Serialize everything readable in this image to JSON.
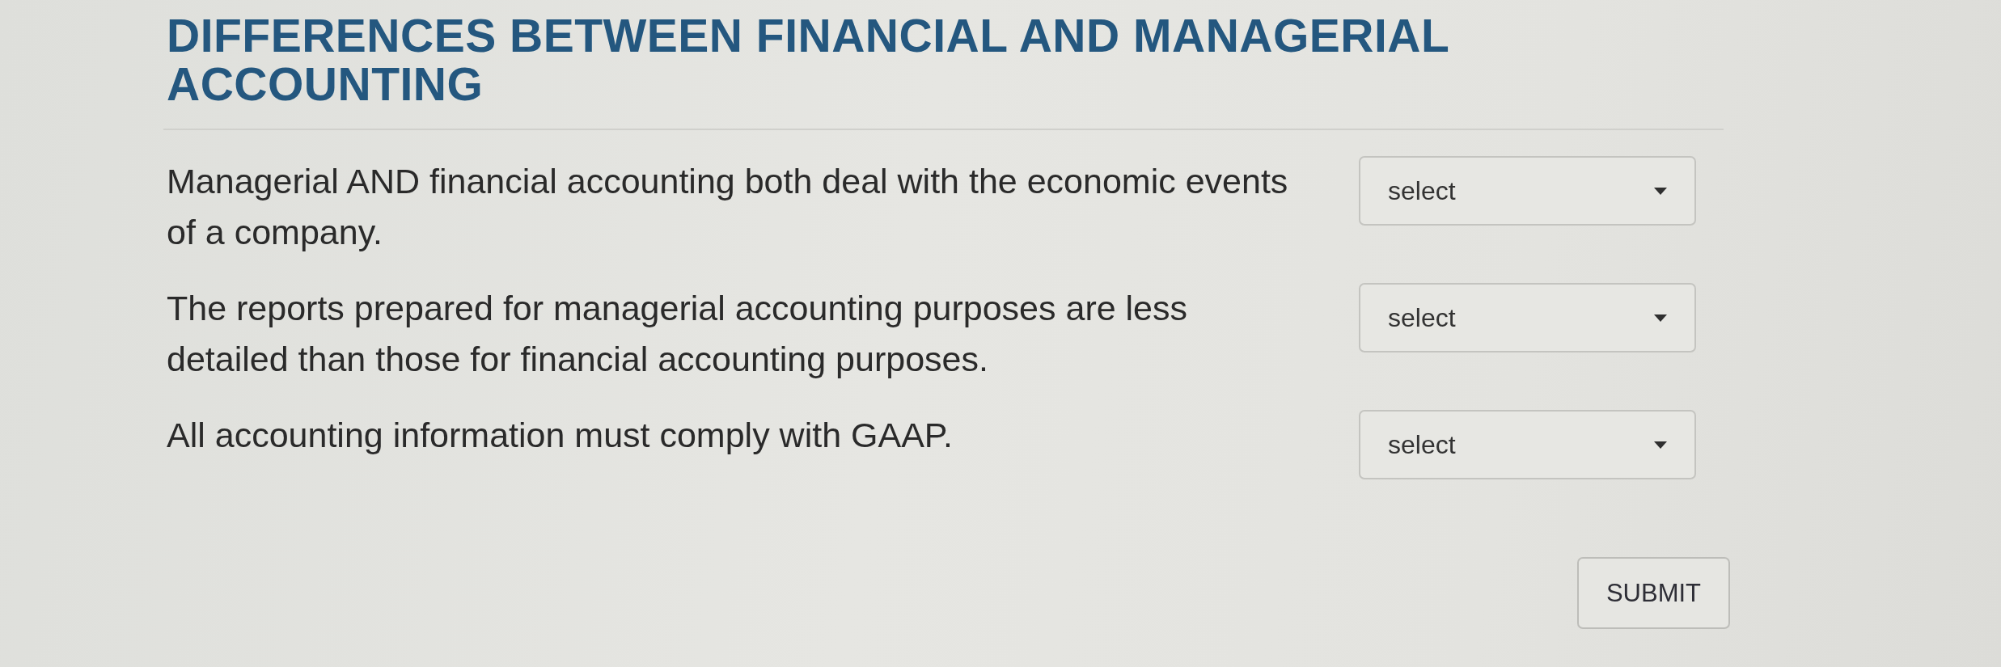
{
  "title": "DIFFERENCES BETWEEN FINANCIAL AND MANAGERIAL ACCOUNTING",
  "questions": [
    {
      "text": "Managerial AND financial accounting both deal with the economic events of a company.",
      "select": {
        "placeholder": "select"
      }
    },
    {
      "text": "The reports prepared for managerial accounting purposes are less detailed than those for financial accounting purposes.",
      "select": {
        "placeholder": "select"
      }
    },
    {
      "text": "All accounting information must comply with GAAP.",
      "select": {
        "placeholder": "select"
      }
    }
  ],
  "submit_button": {
    "label": "SUBMIT"
  }
}
